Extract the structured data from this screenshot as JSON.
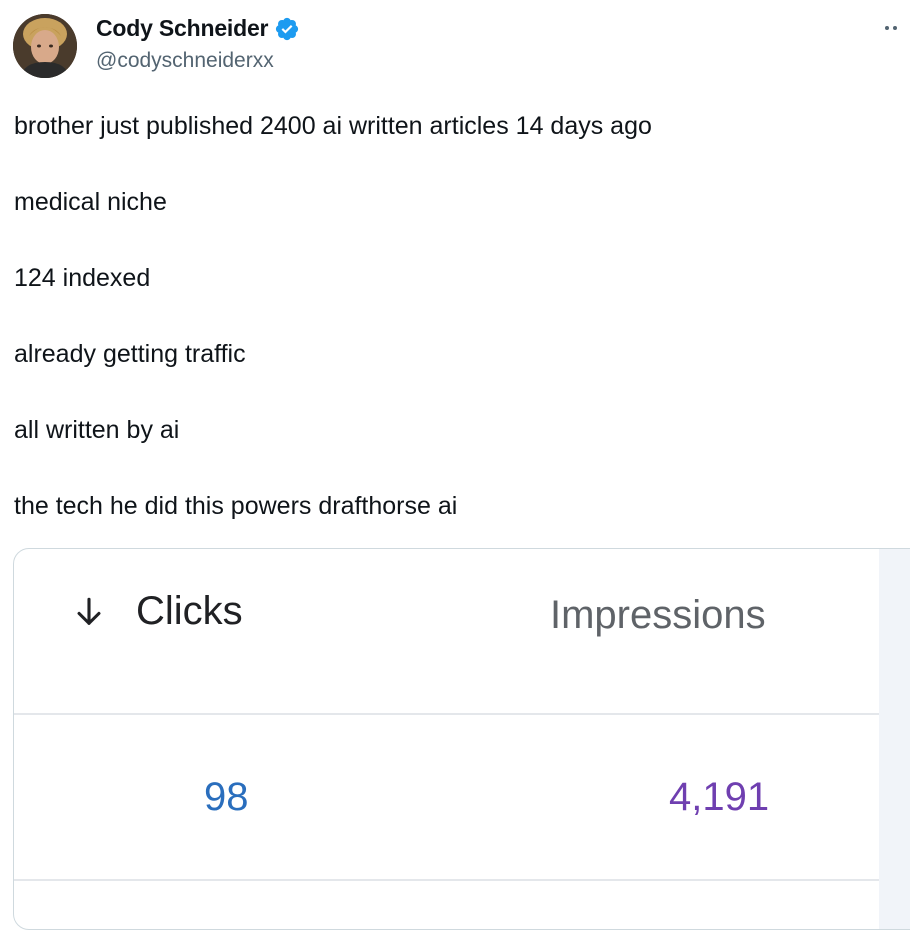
{
  "author": {
    "display_name": "Cody Schneider",
    "handle": "@codyschneiderxx",
    "verified": true,
    "verified_color": "#1d9bf0",
    "avatar_icon": "avatar"
  },
  "tweet": {
    "lines": [
      "brother just published 2400 ai written articles 14 days ago",
      "medical niche",
      "124 indexed",
      "already getting traffic",
      "all written by ai",
      "the tech he did this powers drafthorse ai"
    ]
  },
  "media": {
    "columns": {
      "clicks_label": "Clicks",
      "impressions_label": "Impressions",
      "sort_icon": "arrow-down-icon"
    },
    "values": {
      "clicks": "98",
      "impressions": "4,191"
    },
    "colors": {
      "clicks": "#2a6ebd",
      "impressions": "#6f3fb0"
    }
  }
}
